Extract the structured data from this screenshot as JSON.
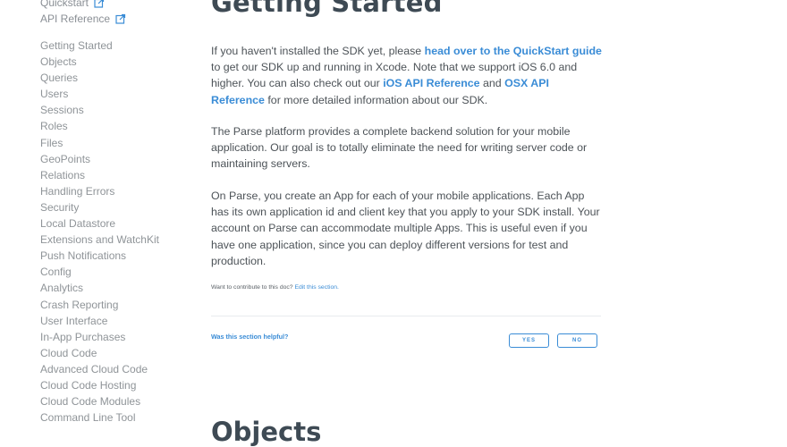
{
  "sidebar": {
    "links": [
      {
        "label": "Quickstart",
        "icon": "external-link-icon"
      },
      {
        "label": "API Reference",
        "icon": "external-link-icon"
      }
    ],
    "nav": [
      "Getting Started",
      "Objects",
      "Queries",
      "Users",
      "Sessions",
      "Roles",
      "Files",
      "GeoPoints",
      "Relations",
      "Handling Errors",
      "Security",
      "Local Datastore",
      "Extensions and WatchKit",
      "Push Notifications",
      "Config",
      "Analytics",
      "Crash Reporting",
      "User Interface",
      "In-App Purchases",
      "Cloud Code",
      "Advanced Cloud Code",
      "Cloud Code Hosting",
      "Cloud Code Modules",
      "Command Line Tool"
    ]
  },
  "main": {
    "title": "Getting Started",
    "p1": {
      "t1": "If you haven't installed the SDK yet, please ",
      "link1": "head over to the QuickStart guide",
      "t2": " to get our SDK up and running in Xcode. Note that we support iOS 6.0 and higher. You can also check out our ",
      "link2": "iOS API Reference",
      "t3": " and ",
      "link3": "OSX API Reference",
      "t4": " for more detailed information about our SDK."
    },
    "p2": "The Parse platform provides a complete backend solution for your mobile application. Our goal is to totally eliminate the need for writing server code or maintaining servers.",
    "p3": "On Parse, you create an App for each of your mobile applications. Each App has its own application id and client key that you apply to your SDK install. Your account on Parse can accommodate multiple Apps. This is useful even if you have one application, since you can deploy different versions for test and production.",
    "contribute": {
      "text": "Want to contribute to this doc? ",
      "link": "Edit this section."
    },
    "feedback": {
      "question": "Was this section helpful?",
      "yes": "YES",
      "no": "NO"
    },
    "next_heading": "Objects"
  },
  "colors": {
    "link": "#3a8cd6",
    "heading": "#3e4a54",
    "nav": "#8f9498"
  }
}
